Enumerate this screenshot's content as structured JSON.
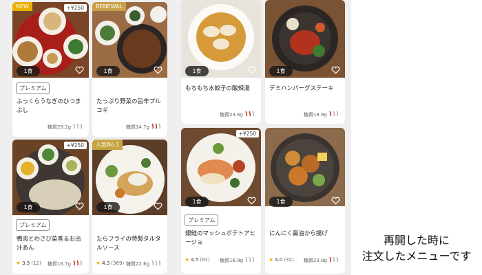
{
  "cards": [
    {
      "tag": "NEW",
      "surcharge": "+¥250",
      "portion": "1食",
      "premium": "プレミアム",
      "name": "ふっくらうなぎのひつまぶし",
      "carb": "糖質29.2g"
    },
    {
      "tag": "RENEWAL",
      "portion": "1食",
      "name": "たっぷり野菜の旨辛プルコギ",
      "carb": "糖質14.7g"
    },
    {
      "portion": "1食",
      "name": "もちもち水餃子の酸辣湯",
      "carb": "糖質23.6g"
    },
    {
      "portion": "1食",
      "name": "デミハンバーグステーキ",
      "carb": "糖質18.8g"
    },
    {
      "surcharge": "+¥250",
      "portion": "1食",
      "premium": "プレミアム",
      "name": "鴨肉とわさび菜香るお出汁あん",
      "rating": "3.5",
      "rating_count": "(12)",
      "carb": "糖質16.7g"
    },
    {
      "tag": "人気No.1",
      "portion": "1食",
      "name": "たらフライの特製タルタルソース",
      "rating": "4.3",
      "rating_count": "(369)",
      "carb": "糖質22.6g"
    },
    {
      "surcharge": "+¥250",
      "portion": "1食",
      "premium": "プレミアム",
      "name": "銀鮭のマッシュポテトアヒージョ",
      "rating": "4.5",
      "rating_count": "(91)",
      "carb": "糖質16.9g"
    },
    {
      "portion": "1食",
      "name": "にんにく醤油から揚げ",
      "rating": "4.0",
      "rating_count": "(32)",
      "carb": "糖質23.8g"
    }
  ],
  "caption": {
    "line1": "再開した時に",
    "line2": "注文したメニューです"
  },
  "colors": {
    "chili_red": "#c0392b",
    "chili_gray": "#b5b5b5",
    "star": "#f0b400"
  }
}
